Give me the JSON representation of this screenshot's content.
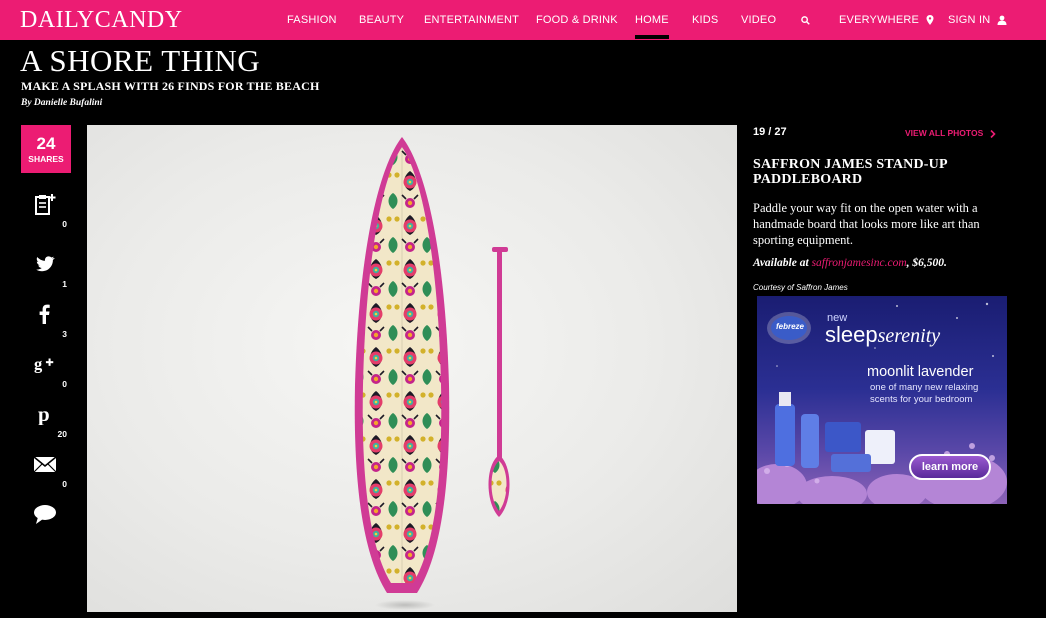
{
  "site": {
    "logo": "DAILYCANDY",
    "brand_color": "#ec1c73"
  },
  "nav": {
    "items": [
      {
        "label": "FASHION"
      },
      {
        "label": "BEAUTY"
      },
      {
        "label": "ENTERTAINMENT"
      },
      {
        "label": "FOOD & DRINK"
      },
      {
        "label": "HOME",
        "active": true
      },
      {
        "label": "KIDS"
      },
      {
        "label": "VIDEO"
      }
    ],
    "search_icon": "search-icon",
    "location_label": "EVERYWHERE",
    "signin_label": "SIGN IN"
  },
  "article": {
    "title": "A SHORE THING",
    "subtitle": "MAKE A SPLASH WITH 26 FINDS FOR THE BEACH",
    "byline": "By Danielle Bufalini"
  },
  "share": {
    "total": "24",
    "total_label": "SHARES",
    "items": [
      {
        "icon": "clipboard-add-icon",
        "count": "0"
      },
      {
        "icon": "twitter-icon",
        "count": "1"
      },
      {
        "icon": "facebook-icon",
        "count": "3"
      },
      {
        "icon": "google-plus-icon",
        "count": "0"
      },
      {
        "icon": "pinterest-icon",
        "count": "20"
      },
      {
        "icon": "email-icon",
        "count": "0"
      },
      {
        "icon": "comment-icon",
        "count": ""
      }
    ]
  },
  "gallery": {
    "counter": "19 / 27",
    "view_all": "VIEW ALL PHOTOS",
    "item_title": "SAFFRON JAMES STAND-UP PADDLEBOARD",
    "description": "Paddle your way fit on the open water with a handmade board that looks more like art than sporting equipment.",
    "available_prefix": "Available at",
    "available_link": "saffronjamesinc.com",
    "available_suffix": ", $6,500.",
    "courtesy": "Courtesy of Saffron James"
  },
  "ad": {
    "brand": "febreze",
    "new": "new",
    "line1_a": "sleep",
    "line1_b": "serenity",
    "headline": "moonlit lavender",
    "tagline_1": "one of many new relaxing",
    "tagline_2": "scents for your bedroom",
    "cta": "learn more"
  }
}
